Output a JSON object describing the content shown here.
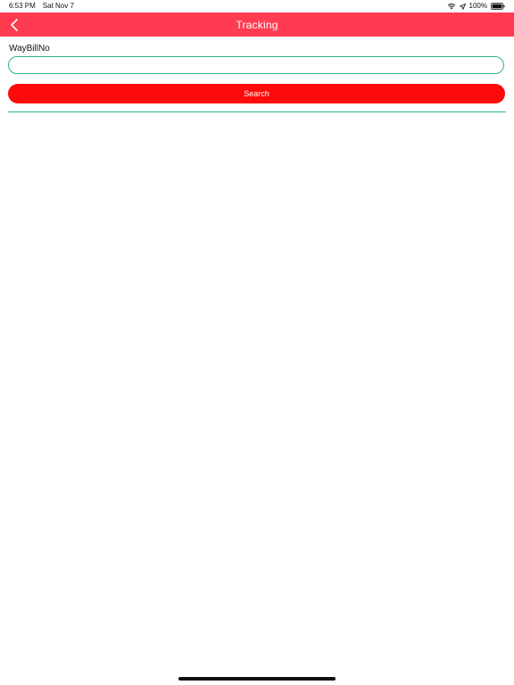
{
  "status_bar": {
    "time": "6:53 PM",
    "date": "Sat Nov 7",
    "battery": "100%",
    "icons": [
      "wifi-icon",
      "location-arrow-icon",
      "battery-icon"
    ]
  },
  "nav_bar": {
    "title": "Tracking",
    "back_icon": "chevron-left-icon",
    "color": "#ff3b52"
  },
  "form": {
    "waybill_label": "WayBillNo",
    "waybill_value": "",
    "waybill_placeholder": "",
    "search_label": "Search",
    "button_color": "#ff0a0a",
    "accent_color": "#2bb38a"
  }
}
